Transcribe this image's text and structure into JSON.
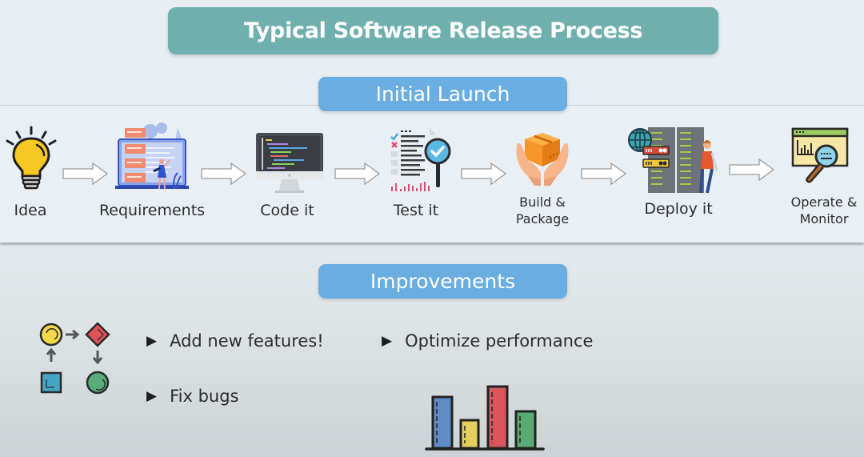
{
  "title": "Typical Software Release Process",
  "sections": {
    "initial_launch": "Initial Launch",
    "improvements": "Improvements"
  },
  "steps": [
    {
      "label": "Idea",
      "icon": "lightbulb-icon"
    },
    {
      "label": "Requirements",
      "icon": "requirements-laptop-icon"
    },
    {
      "label": "Code it",
      "icon": "code-monitor-icon"
    },
    {
      "label": "Test it",
      "icon": "test-report-magnifier-icon"
    },
    {
      "label_line1": "Build &",
      "label_line2": "Package",
      "icon": "package-hands-icon"
    },
    {
      "label": "Deploy it",
      "icon": "server-rack-icon"
    },
    {
      "label_line1": "Operate &",
      "label_line2": "Monitor",
      "icon": "monitor-dashboard-icon"
    }
  ],
  "improvement_items": [
    "Add new features!",
    "Fix bugs",
    "Optimize performance"
  ],
  "bullet_glyph": "▶",
  "colors": {
    "title_bg": "#6fb0ae",
    "section_pill_bg": "#6aade0",
    "band_bg": "#e8eff5",
    "text": "#2e2e2e"
  }
}
